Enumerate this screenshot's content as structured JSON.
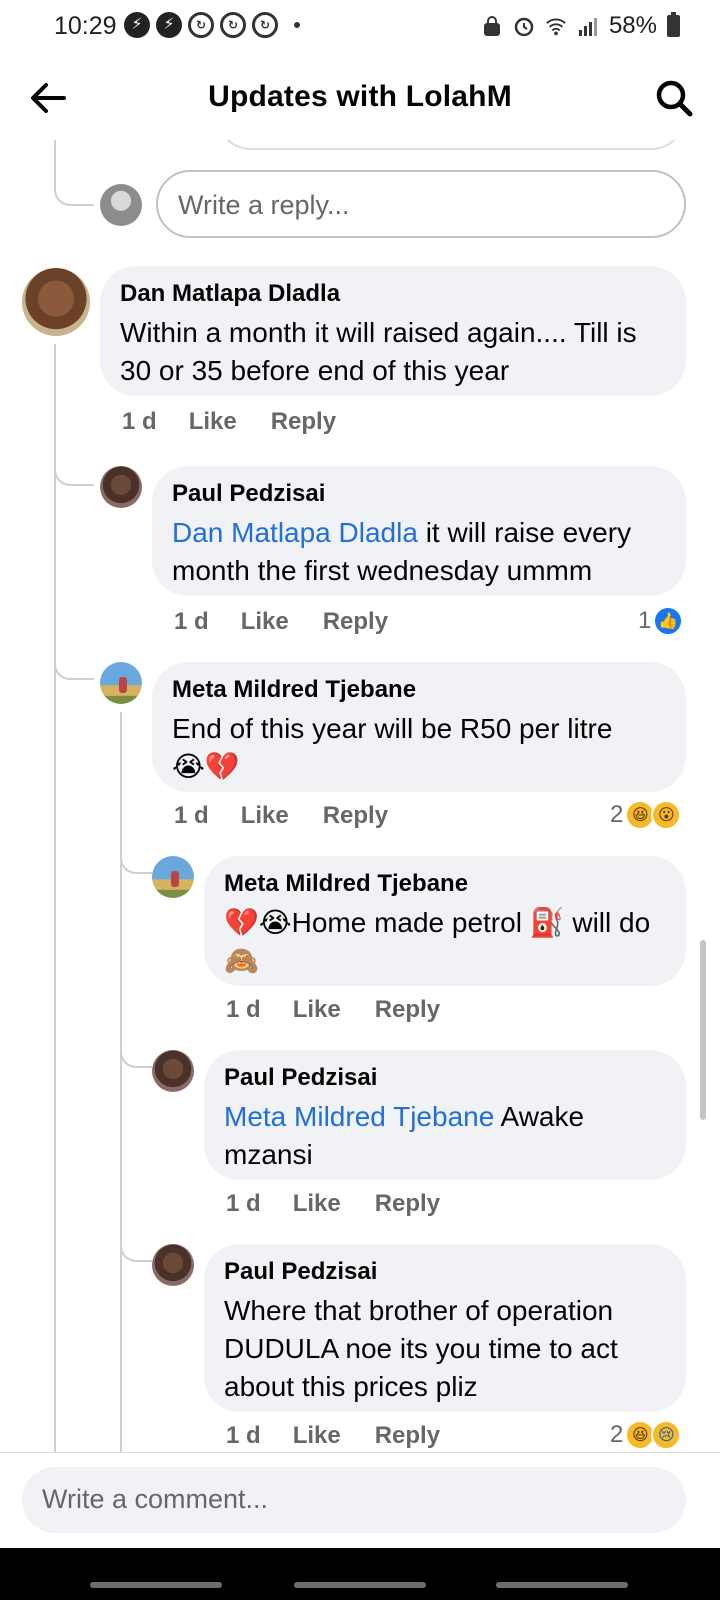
{
  "status_bar": {
    "time": "10:29",
    "battery_percent": "58%",
    "icons": [
      "messenger-icon",
      "messenger-icon",
      "sync-icon",
      "sync-icon",
      "sync-icon",
      "alarm-icon",
      "wifi-icon",
      "signal-icon",
      "battery-icon"
    ]
  },
  "header": {
    "title": "Updates with LolahM",
    "back_icon": "arrow-left-icon",
    "search_icon": "search-icon"
  },
  "reply_box": {
    "placeholder": "Write a reply..."
  },
  "comments": [
    {
      "author": "Dan Matlapa Dladla",
      "text": "Within a month it will raised again.... Till is 30 or 35 before end of this year",
      "time": "1 d",
      "like": "Like",
      "reply": "Reply"
    },
    {
      "author": "Paul Pedzisai",
      "mention": "Dan Matlapa Dladla",
      "text": " it will raise every month the first wednesday  ummm",
      "time": "1 d",
      "like": "Like",
      "reply": "Reply",
      "reaction_count": "1",
      "reactions": [
        "like"
      ]
    },
    {
      "author": "Meta Mildred Tjebane",
      "text": "End of this year will be R50 per litre",
      "emojis": [
        "😭",
        "💔"
      ],
      "time": "1 d",
      "like": "Like",
      "reply": "Reply",
      "reaction_count": "2",
      "reactions": [
        "haha",
        "wow"
      ]
    },
    {
      "author": "Meta Mildred Tjebane",
      "emojis_prefix": [
        "💔",
        "😭"
      ],
      "text_a": "Home made petrol ",
      "emoji_mid": "⛽",
      "text_b": " will do ",
      "emoji_end": "🙈",
      "time": "1 d",
      "like": "Like",
      "reply": "Reply"
    },
    {
      "author": "Paul Pedzisai",
      "mention": "Meta Mildred Tjebane",
      "text": " Awake mzansi",
      "time": "1 d",
      "like": "Like",
      "reply": "Reply"
    },
    {
      "author": "Paul Pedzisai",
      "text": "Where that brother of operation DUDULA noe its you time to act about this prices pliz",
      "time": "1 d",
      "like": "Like",
      "reply": "Reply",
      "reaction_count": "2",
      "reactions": [
        "haha",
        "sad"
      ]
    }
  ],
  "comment_bar": {
    "placeholder": "Write a comment..."
  }
}
